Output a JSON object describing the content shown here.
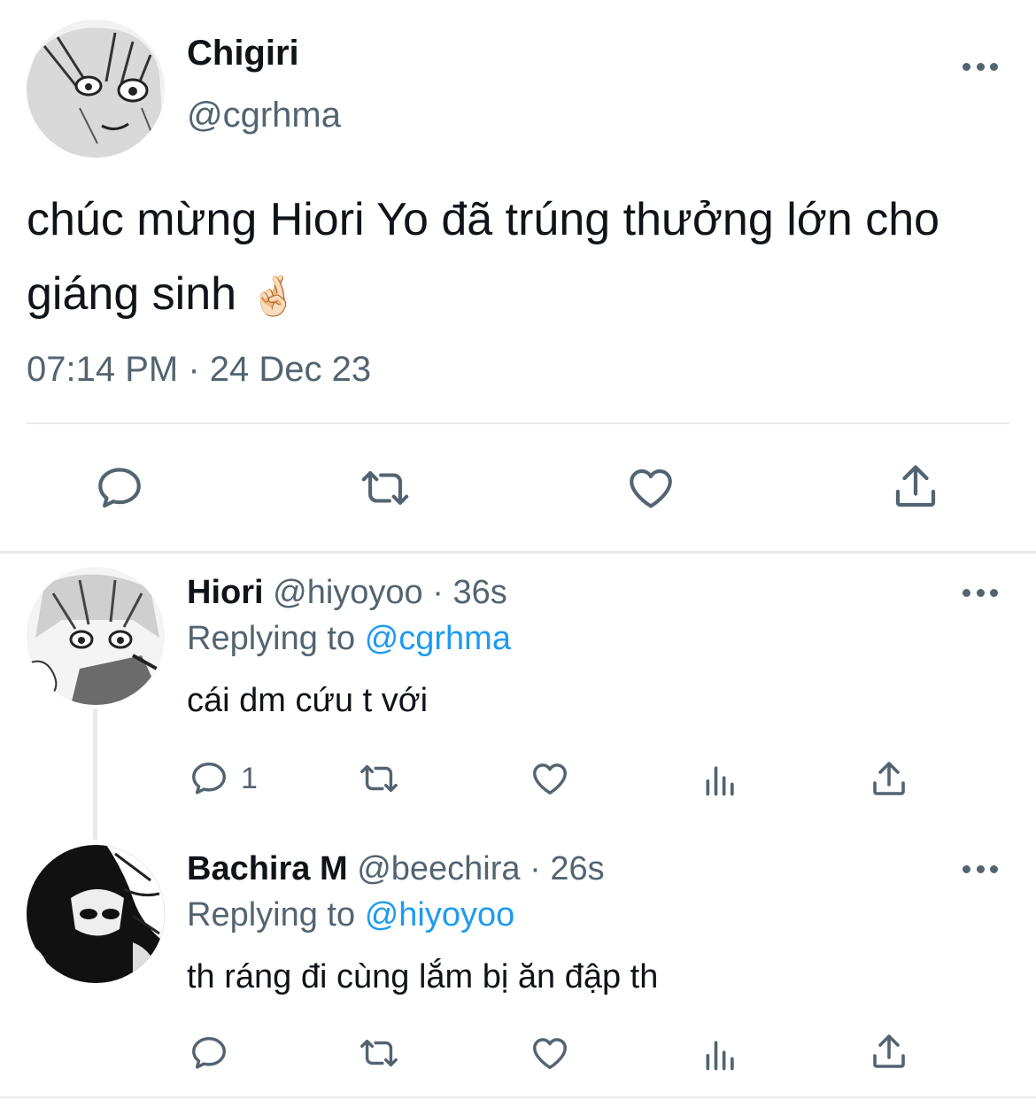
{
  "main_tweet": {
    "display_name": "Chigiri",
    "handle": "@cgrhma",
    "text_line1": "chúc mừng Hiori Yo đã trúng thưởng lớn cho",
    "text_line2": "giáng sinh",
    "emoji": "🤞🏻",
    "timestamp": "07:14 PM · 24 Dec 23",
    "icons": [
      "more-icon",
      "reply-icon",
      "retweet-icon",
      "like-icon",
      "share-icon"
    ]
  },
  "replies": [
    {
      "display_name": "Hiori",
      "handle": "@hiyoyoo",
      "time": "36s",
      "separator": "·",
      "replying_label": "Replying to",
      "replying_to": "@cgrhma",
      "text": "cái dm cứu t với",
      "reply_count": "1"
    },
    {
      "display_name": "Bachira M",
      "handle": "@beechira",
      "time": "26s",
      "separator": "·",
      "replying_label": "Replying to",
      "replying_to": "@hiyoyoo",
      "text": "th ráng đi cùng lắm bị ăn đập th",
      "reply_count": ""
    }
  ],
  "colors": {
    "text": "#0f1419",
    "secondary": "#536471",
    "link": "#1d9bf0",
    "divider": "#e7e9ea"
  }
}
